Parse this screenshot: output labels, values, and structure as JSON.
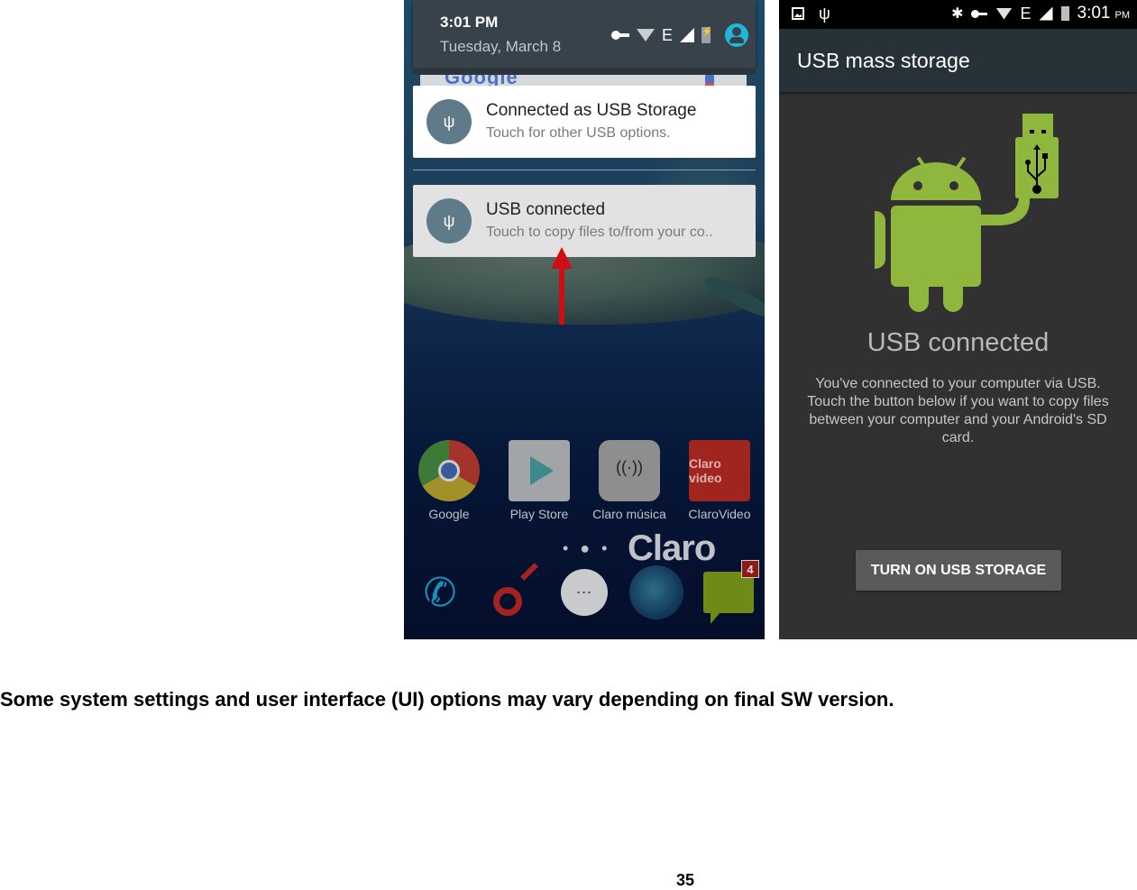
{
  "left_screen": {
    "shade": {
      "time": "3:01 PM",
      "date": "Tuesday, March 8",
      "status_icons": [
        "vpn-key-icon",
        "wifi-icon",
        "edge-network-icon",
        "signal-icon",
        "battery-charging-icon",
        "user-account-icon"
      ],
      "network_label": "E"
    },
    "search_widget": {
      "brand": "Google"
    },
    "notifications": [
      {
        "title": "Connected as USB Storage",
        "subtitle": "Touch for other USB options.",
        "icon": "usb-icon"
      },
      {
        "title": "USB connected",
        "subtitle": "Touch to copy files to/from your co..",
        "icon": "usb-icon"
      }
    ],
    "annotation": {
      "type": "arrow-up",
      "color": "#d00d12"
    },
    "apps": [
      {
        "label": "Google",
        "icon": "chrome-icon"
      },
      {
        "label": "Play Store",
        "icon": "play-store-icon"
      },
      {
        "label": "Claro música",
        "icon": "claro-musica-icon"
      },
      {
        "label": "ClaroVideo",
        "icon": "claro-video-icon",
        "icon_text": "Claro video"
      }
    ],
    "page_dots": "• ● •",
    "carrier_logo": "Claro",
    "dock": [
      {
        "name": "phone",
        "icon": "phone-icon"
      },
      {
        "name": "claro",
        "icon": "claro-icon"
      },
      {
        "name": "all-apps",
        "icon": "app-drawer-icon",
        "glyph": "⋯"
      },
      {
        "name": "browser",
        "icon": "globe-icon"
      },
      {
        "name": "messaging",
        "icon": "messaging-icon",
        "badge": "4"
      }
    ],
    "usb_glyph": "ψ"
  },
  "right_screen": {
    "status_bar": {
      "left_icons": [
        "screenshot-icon",
        "usb-icon"
      ],
      "right_icons": [
        "bluetooth-icon",
        "vpn-key-icon",
        "wifi-icon",
        "edge-network-icon",
        "signal-icon",
        "battery-charging-icon"
      ],
      "bluetooth_glyph": "✱",
      "network_label": "E",
      "time": "3:01",
      "ampm": "PM",
      "usb_glyph": "ψ"
    },
    "app_bar": {
      "title": "USB mass storage"
    },
    "heading": "USB connected",
    "description": "You've connected to your computer via USB. Touch the button below if you want to copy files between your computer and your Android's SD card.",
    "button_label": "TURN ON USB STORAGE",
    "colors": {
      "android_green": "#8fb73e",
      "app_bar": "#263238",
      "background": "#313131"
    }
  },
  "document": {
    "disclaimer": "Some system settings and user interface (UI) options may vary depending on final SW version.",
    "page_number": "35"
  }
}
